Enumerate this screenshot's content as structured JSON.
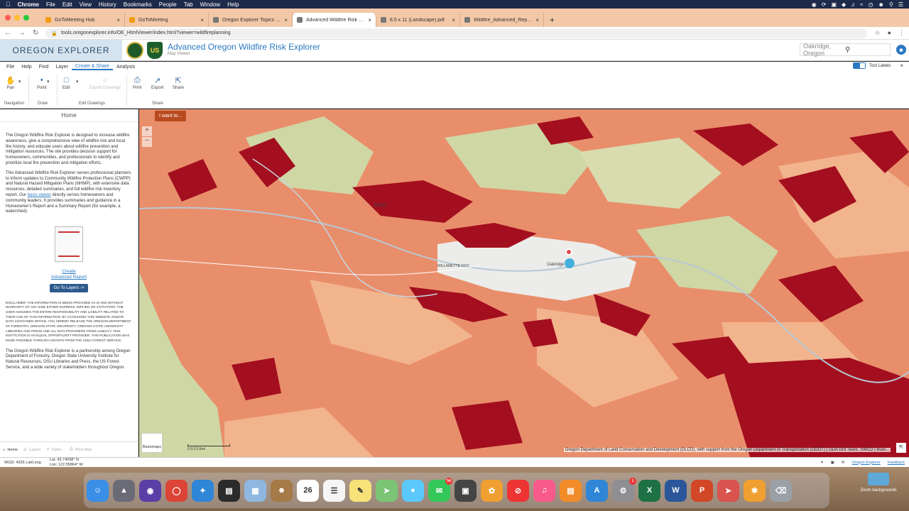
{
  "mac_menu": {
    "app": "Chrome",
    "items": [
      "File",
      "Edit",
      "View",
      "History",
      "Bookmarks",
      "People",
      "Tab",
      "Window",
      "Help"
    ]
  },
  "browser": {
    "tabs": [
      {
        "title": "GoToMeeting Hub",
        "color": "#f39c12",
        "active": false
      },
      {
        "title": "GoToMeeting",
        "color": "#f39c12",
        "active": false
      },
      {
        "title": "Oregon Explorer Topics | oregon",
        "color": "#777777",
        "active": false
      },
      {
        "title": "Advanced Wildfire Risk Explorer",
        "color": "#777777",
        "active": true
      },
      {
        "title": "8.5 x 11 (Landscape).pdf",
        "color": "#777777",
        "active": false
      },
      {
        "title": "Wildfire_Advanced_Report_Oak...",
        "color": "#777777",
        "active": false
      }
    ],
    "url": "tools.oregonexplorer.info/OE_HtmlViewer/index.html?viewer=wildfireplanning"
  },
  "app": {
    "logo_text": "OREGON EXPLORER",
    "shield_text": "US",
    "title": "Advanced Oregon Wildfire Risk Explorer",
    "subtitle": "Map Viewer",
    "search_value": "Oakridge, Oregon",
    "accent": "#2a78c2"
  },
  "menu": {
    "items": [
      "File",
      "Help",
      "Find",
      "Layer",
      "Create & Share",
      "Analysis"
    ],
    "active": "Create & Share",
    "tool_labels": "Tool Labels"
  },
  "toolbar": {
    "pan": "Pan",
    "point": "Point",
    "edit": "Edit",
    "export_drawings": "Export Drawings",
    "print": "Print",
    "export": "Export",
    "share": "Share",
    "groups": {
      "navigation": "Navigation",
      "draw": "Draw",
      "edit_drawings": "Edit Drawings",
      "share": "Share"
    }
  },
  "panel": {
    "title": "Home",
    "intro": "The Oregon Wildfire Risk Explorer is designed to increase wildfire awareness, give a comprehensive view of wildfire risk and local fire history, and educate users about wildfire prevention and mitigation resources. The site provides decision support for homeowners, communities, and professionals to identify and prioritize local fire prevention and mitigation efforts.",
    "p2_before": "This Advanced Wildfire Risk Explorer serves professional planners to inform updates to Community Wildfire Protection Plans (CWPP) and Natural Hazard Mitigation Plans (NHMP), with extensive data resources, detailed summaries, and full wildfire risk inventory report. Our ",
    "p2_link": "basic viewer",
    "p2_after": " directly serves homeowners and community leaders. It provides summaries and guidance in a Homeowner's Report and a Summary Report (for example, a watershed).",
    "create_line1": "Create",
    "create_line2": "Advanced Report",
    "goto_btn": "Go To Layers ->",
    "disclaimer": "DISCLAIMER: THE INFORMATION IS BEING PROVIDED AS IS AND WITHOUT WARRANTY OF ANY KIND EITHER EXPRESS, IMPLIED OR STATUTORY. THE USER ASSUMES THE ENTIRE RESPONSIBILITY AND LIABILITY RELATED TO THEIR USE OF THIS INFORMATION. BY ACCESSING THIS WEBSITE AND/OR DATA CONTAINED WITHIN, YOU HEREBY RELEASE THE OREGON DEPARTMENT OF FORESTRY, OREGON STATE UNIVERSITY, OREGON STATE UNIVERSITY LIBRARIES AND PRESS AND ALL DATA PROVIDERS FROM LIABILITY. THIS INSTITUTION IS AN EQUAL OPPORTUNITY PROVIDER. THIS PUBLICATION WAS MADE POSSIBLE THROUGH GRANTS FROM THE USDA FOREST SERVICE.",
    "partnership": "The Oregon Wildfire Risk Explorer is a partnership among Oregon Department of Forestry, Oregon State University Institute for Natural Resources, OSU Libraries and Press, the US Forest Service, and a wide variety of stakeholders throughout Oregon.",
    "footer_tabs": [
      "Home",
      "Layers",
      "Oakri...",
      "Print Map"
    ]
  },
  "map": {
    "i_want_to": "I want to...",
    "basemaps": "Basemaps",
    "scale_label": "0     0.3     0.6mi",
    "attribution": "Oregon Department of Land Conservation and Development (DLCD), with support from the Oregon Department of Transportation (ODOT) | ODA GIS Team, SWCD | Bure...",
    "town_oakridge": "Oakridge",
    "town_westfir": "Westfir",
    "town_willamette": "WILLAMETTE CITY",
    "colors": {
      "dark": "#a30f1f",
      "high": "#e26550",
      "moderate": "#f2b48c",
      "low": "#cfd7a5",
      "urban": "#ececea"
    }
  },
  "status": {
    "projection": "WGD: 4326 Lat/Long",
    "lat": "Lat: 43.74098° N",
    "lon": "Lon: 122.55864° W",
    "link1": "Oregon Explorer",
    "link2": "Feedback"
  },
  "dock": {
    "calendar_day": "26",
    "messages_badge": "54",
    "settings_badge": "1",
    "zoom_backgrounds": "Zoom backgrounds"
  }
}
